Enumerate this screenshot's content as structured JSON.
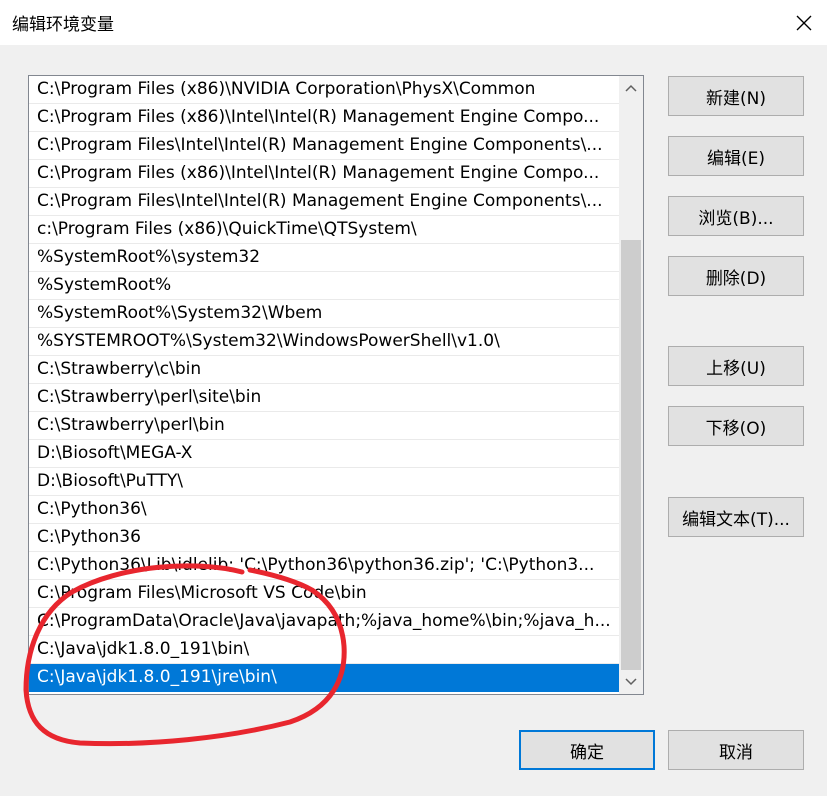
{
  "window": {
    "title": "编辑环境变量",
    "close_icon": "close-icon"
  },
  "path_list": {
    "items": [
      "C:\\Program Files (x86)\\NVIDIA Corporation\\PhysX\\Common",
      "C:\\Program Files (x86)\\Intel\\Intel(R) Management Engine Compo...",
      "C:\\Program Files\\Intel\\Intel(R) Management Engine Components\\...",
      "C:\\Program Files (x86)\\Intel\\Intel(R) Management Engine Compo...",
      "C:\\Program Files\\Intel\\Intel(R) Management Engine Components\\...",
      "c:\\Program Files (x86)\\QuickTime\\QTSystem\\",
      "%SystemRoot%\\system32",
      "%SystemRoot%",
      "%SystemRoot%\\System32\\Wbem",
      "%SYSTEMROOT%\\System32\\WindowsPowerShell\\v1.0\\",
      "C:\\Strawberry\\c\\bin",
      "C:\\Strawberry\\perl\\site\\bin",
      "C:\\Strawberry\\perl\\bin",
      "D:\\Biosoft\\MEGA-X",
      "D:\\Biosoft\\PuTTY\\",
      "C:\\Python36\\",
      "C:\\Python36",
      "C:\\Python36\\Lib\\idlelib; 'C:\\Python36\\python36.zip'; 'C:\\Python3...",
      "C:\\Program Files\\Microsoft VS Code\\bin",
      "C:\\ProgramData\\Oracle\\Java\\javapath;%java_home%\\bin;%java_h...",
      "C:\\Java\\jdk1.8.0_191\\bin\\",
      "C:\\Java\\jdk1.8.0_191\\jre\\bin\\"
    ],
    "selected_index": 21,
    "selection_color": "#0078d7"
  },
  "buttons": {
    "new": "新建(N)",
    "edit": "编辑(E)",
    "browse": "浏览(B)...",
    "delete": "删除(D)",
    "move_up": "上移(U)",
    "move_down": "下移(O)",
    "edit_text": "编辑文本(T)...",
    "ok": "确定",
    "cancel": "取消"
  },
  "annotation": {
    "color": "#e8262e"
  }
}
